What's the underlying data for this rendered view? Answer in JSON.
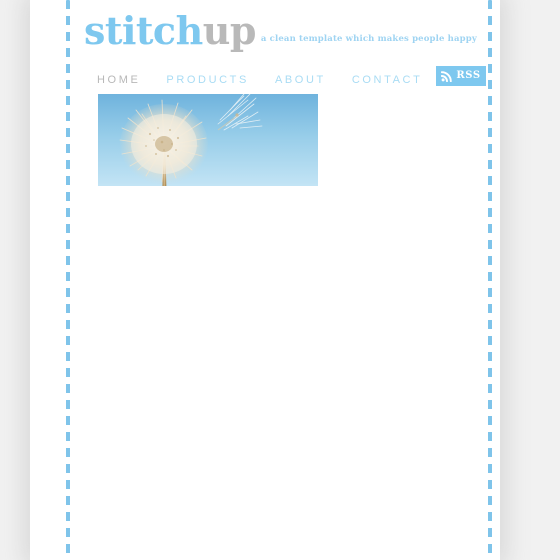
{
  "site": {
    "logo_primary": "stitch",
    "logo_secondary": "up",
    "tagline": "a clean template which makes people happy"
  },
  "nav": {
    "items": [
      {
        "label": "HOME",
        "current": true
      },
      {
        "label": "PRODUCTS",
        "current": false
      },
      {
        "label": "ABOUT",
        "current": false
      },
      {
        "label": "CONTACT",
        "current": false
      }
    ]
  },
  "rss": {
    "label": "RSS",
    "icon": "rss-feed-icon"
  },
  "hero": {
    "alt": "dandelion seedhead against a blue sky with a single seed drifting away",
    "icon": "dandelion-photo"
  },
  "colors": {
    "accent_blue": "#7ec8ef",
    "nav_blue": "#a9dcf4",
    "nav_gray": "#b8b8b8",
    "logo_gray": "#b9b9b9",
    "tagline_blue": "#9fd4f2",
    "stitch_blue": "#7fc4ea",
    "page_background": "#f1f1f1",
    "sheet_background": "#ffffff",
    "sky_top": "#74b6de",
    "sky_bottom": "#bfe2f4",
    "seed_cream": "#f3ead9",
    "stem_tan": "#b99a63"
  }
}
